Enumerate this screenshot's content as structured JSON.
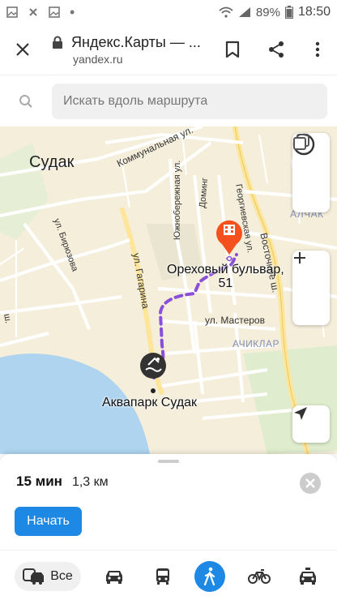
{
  "status_bar": {
    "battery_percent": "89%",
    "time": "18:50"
  },
  "browser": {
    "page_title": "Яндекс.Карты — ...",
    "url": "yandex.ru"
  },
  "search": {
    "placeholder": "Искать вдоль маршрута"
  },
  "map": {
    "city": "Судак",
    "streets": [
      "Коммунальная ул.",
      "Южнобережная ул.",
      "Доминг",
      "Георгиевская ул.",
      "Восточное ш.",
      "ул. Бирюзова",
      "ул. Гагарина",
      "ул. Мастеров",
      "ш."
    ],
    "districts": [
      "АЛЧАК",
      "АЧИКЛАР"
    ],
    "destination": {
      "line1": "Ореховый бульвар,",
      "line2": "51"
    },
    "origin": "Аквапарк Судак",
    "colors": {
      "route": "#8a4fd8",
      "destination_pin": "#f4511e",
      "sea": "#aed4ef",
      "land": "#f5eedb",
      "road": "#ffffff",
      "highway": "#fde69a",
      "green": "#d8ecc2"
    }
  },
  "route": {
    "duration": "15 мин",
    "distance": "1,3 км",
    "start_label": "Начать"
  },
  "transport": {
    "all_label": "Все",
    "modes": [
      "car-icon",
      "bus-icon",
      "walk-icon",
      "bicycle-icon",
      "taxi-icon"
    ],
    "active_mode": "walk"
  },
  "accent_color": "#1e88e5"
}
